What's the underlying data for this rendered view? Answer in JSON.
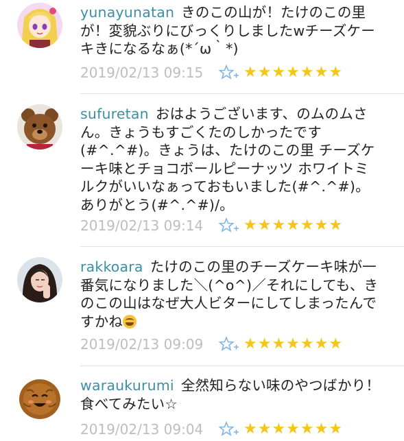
{
  "comments": [
    {
      "username": "yunayunatan",
      "text": "きのこの山が！たけのこの里が！変貌ぶりにびっくりしましたwチーズケーキきになるなぁ(*´ω｀*)",
      "timestamp": "2019/02/13 09:15",
      "stars": "★★★★★★★",
      "star_count": 7,
      "avatar": "anime-girl-avatar"
    },
    {
      "username": "sufuretan",
      "text": "おはようございます、のムのムさん。きょうもすごくたのしかったです(#^.^#)。きょうは、たけのこの里 チーズケーキ味とチョコボールピーナッツ ホワイトミルクがいいなぁっておもいました(#^.^#)。ありがとう(#^.^#)/。",
      "timestamp": "2019/02/13 09:14",
      "stars": "★★★★★★★",
      "star_count": 7,
      "avatar": "teddy-bear-avatar"
    },
    {
      "username": "rakkoara",
      "text": "たけのこの里のチーズケーキ味が一番気になりました＼(^o^)／それにしても、きのこの山はなぜ大人ビターにしてしまったんですかね",
      "timestamp": "2019/02/13 09:09",
      "stars": "★★★★★★★",
      "star_count": 7,
      "avatar": "woman-photo-avatar",
      "trailing_emoji": "grinning-sweat-emoji"
    },
    {
      "username": "waraukurumi",
      "text": "全然知らない味のやつばかり！食べてみたい☆",
      "timestamp": "2019/02/13 09:04",
      "stars": "★★★★★★★",
      "star_count": 7,
      "avatar": "smiling-walnut-avatar"
    }
  ],
  "colors": {
    "username": "#3a8fa6",
    "text": "#222222",
    "timestamp": "#bdbdbd",
    "star": "#f5c518",
    "add_star_icon": "#7fb4e6"
  }
}
